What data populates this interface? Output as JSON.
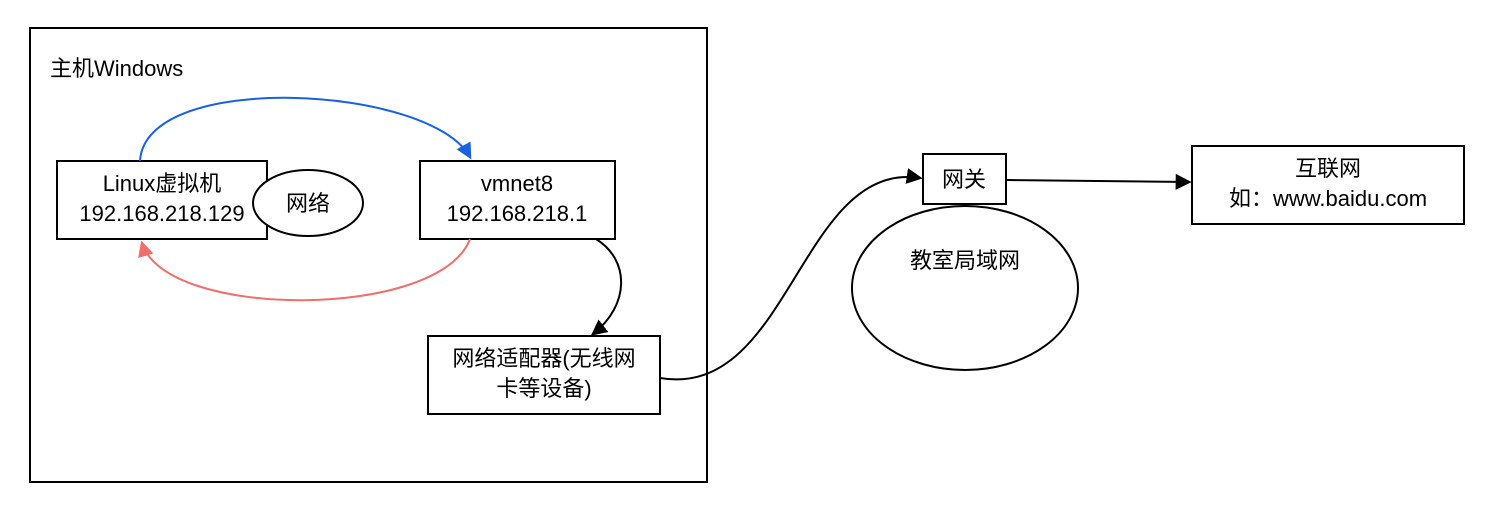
{
  "host": {
    "title": "主机Windows",
    "vm": {
      "name": "Linux虚拟机",
      "ip": "192.168.218.129"
    },
    "network_label": "网络",
    "vmnet": {
      "name": "vmnet8",
      "ip": "192.168.218.1"
    },
    "adapter": {
      "line1": "网络适配器(无线网",
      "line2": "卡等设备)"
    }
  },
  "gateway": "网关",
  "lan": "教室局域网",
  "internet": {
    "line1": "互联网",
    "line2": "如：www.baidu.com"
  }
}
